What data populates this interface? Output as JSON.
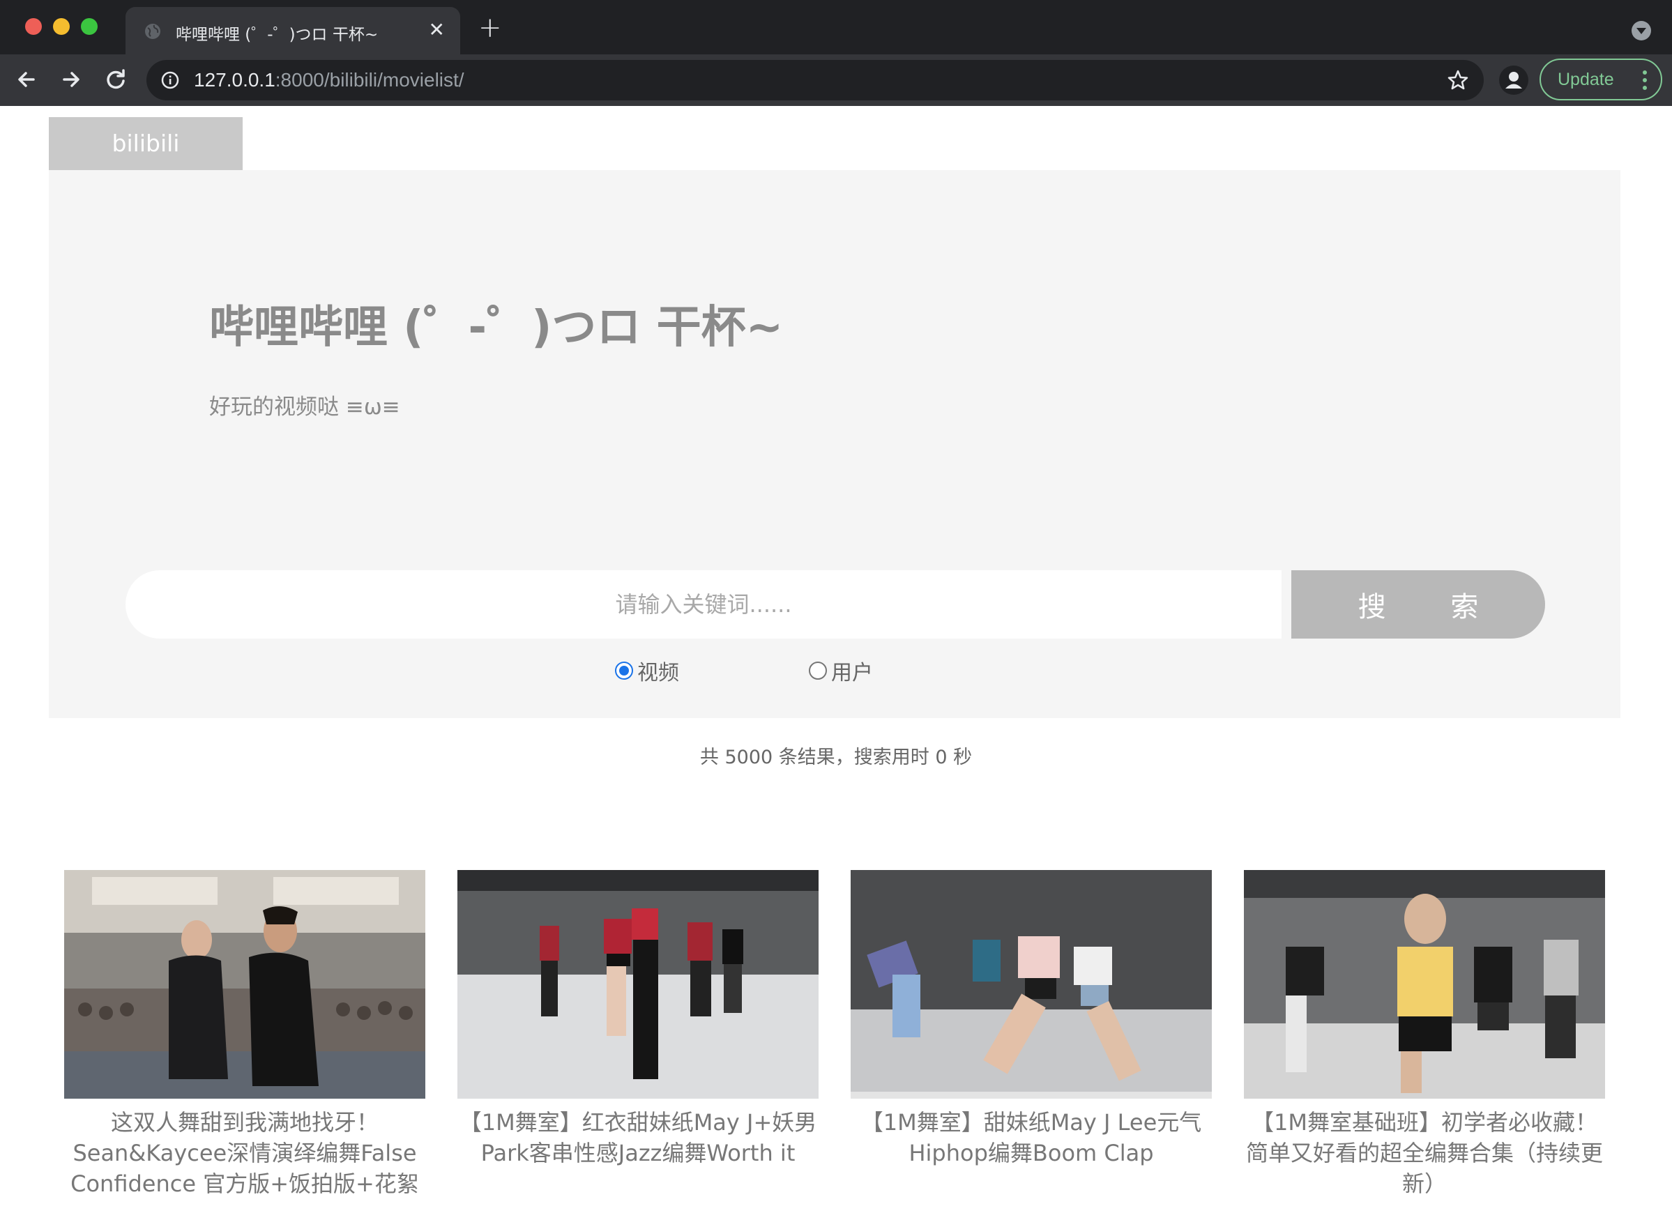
{
  "browser": {
    "tab_title": "哔哩哔哩 (゜-゜)つロ 干杯~",
    "url_host": "127.0.0.1",
    "url_rest": ":8000/bilibili/movielist/",
    "update_label": "Update"
  },
  "header": {
    "brand": "bilibili",
    "title": "哔哩哔哩 (゜-゜)つロ 干杯~",
    "subtitle": "好玩的视频哒 ≡ω≡"
  },
  "search": {
    "placeholder": "请输入关键词......",
    "button_label": "搜 索",
    "options": [
      {
        "label": "视频",
        "checked": true
      },
      {
        "label": "用户",
        "checked": false
      }
    ]
  },
  "results": {
    "summary": "共 5000 条结果，搜索用时 0 秒",
    "videos": [
      {
        "title": "这双人舞甜到我满地找牙！Sean&Kaycee深情演绎编舞False Confidence 官方版+饭拍版+花絮"
      },
      {
        "title": "【1M舞室】红衣甜妹纸May J+妖男Park客串性感Jazz编舞Worth it"
      },
      {
        "title": "【1M舞室】甜妹纸May J Lee元气Hiphop编舞Boom Clap"
      },
      {
        "title": "【1M舞室基础班】初学者必收藏！简单又好看的超全编舞合集（持续更新）"
      }
    ]
  }
}
